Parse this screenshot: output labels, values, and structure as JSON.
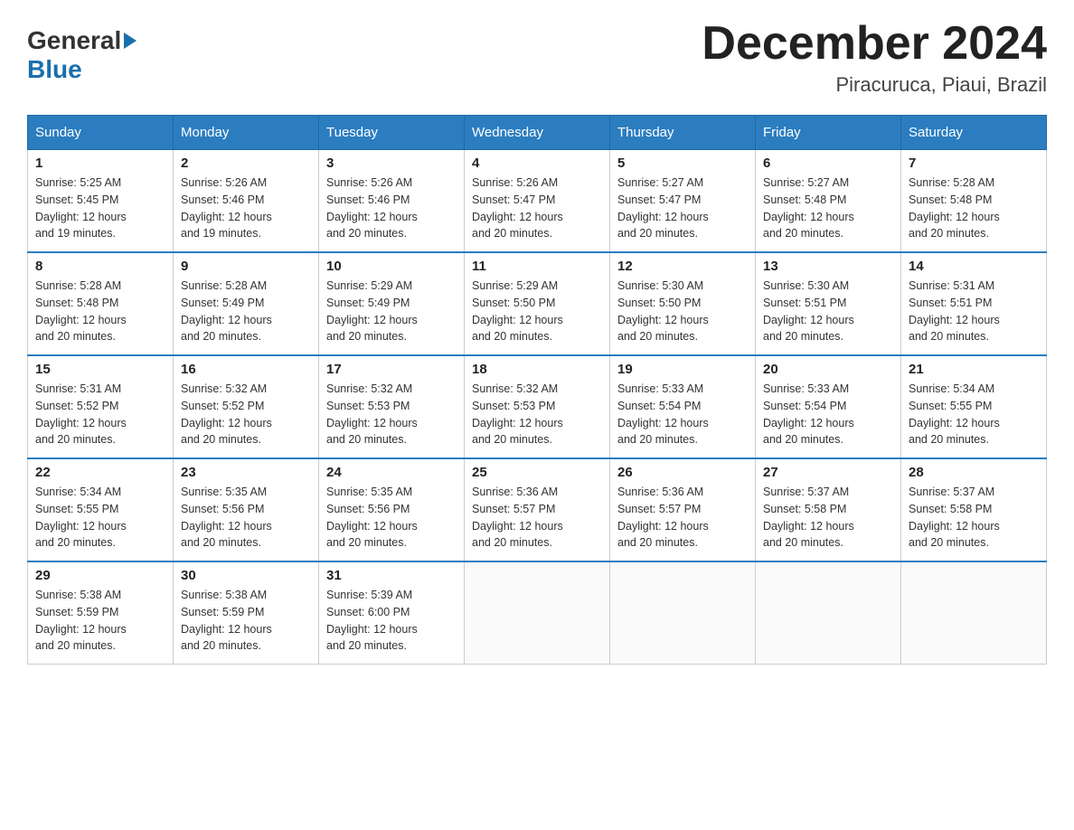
{
  "logo": {
    "text_general": "General",
    "text_blue": "Blue",
    "arrow": "▶"
  },
  "title": {
    "month_year": "December 2024",
    "location": "Piracuruca, Piaui, Brazil"
  },
  "headers": [
    "Sunday",
    "Monday",
    "Tuesday",
    "Wednesday",
    "Thursday",
    "Friday",
    "Saturday"
  ],
  "weeks": [
    [
      {
        "day": "1",
        "sunrise": "5:25 AM",
        "sunset": "5:45 PM",
        "daylight": "12 hours and 19 minutes."
      },
      {
        "day": "2",
        "sunrise": "5:26 AM",
        "sunset": "5:46 PM",
        "daylight": "12 hours and 19 minutes."
      },
      {
        "day": "3",
        "sunrise": "5:26 AM",
        "sunset": "5:46 PM",
        "daylight": "12 hours and 20 minutes."
      },
      {
        "day": "4",
        "sunrise": "5:26 AM",
        "sunset": "5:47 PM",
        "daylight": "12 hours and 20 minutes."
      },
      {
        "day": "5",
        "sunrise": "5:27 AM",
        "sunset": "5:47 PM",
        "daylight": "12 hours and 20 minutes."
      },
      {
        "day": "6",
        "sunrise": "5:27 AM",
        "sunset": "5:48 PM",
        "daylight": "12 hours and 20 minutes."
      },
      {
        "day": "7",
        "sunrise": "5:28 AM",
        "sunset": "5:48 PM",
        "daylight": "12 hours and 20 minutes."
      }
    ],
    [
      {
        "day": "8",
        "sunrise": "5:28 AM",
        "sunset": "5:48 PM",
        "daylight": "12 hours and 20 minutes."
      },
      {
        "day": "9",
        "sunrise": "5:28 AM",
        "sunset": "5:49 PM",
        "daylight": "12 hours and 20 minutes."
      },
      {
        "day": "10",
        "sunrise": "5:29 AM",
        "sunset": "5:49 PM",
        "daylight": "12 hours and 20 minutes."
      },
      {
        "day": "11",
        "sunrise": "5:29 AM",
        "sunset": "5:50 PM",
        "daylight": "12 hours and 20 minutes."
      },
      {
        "day": "12",
        "sunrise": "5:30 AM",
        "sunset": "5:50 PM",
        "daylight": "12 hours and 20 minutes."
      },
      {
        "day": "13",
        "sunrise": "5:30 AM",
        "sunset": "5:51 PM",
        "daylight": "12 hours and 20 minutes."
      },
      {
        "day": "14",
        "sunrise": "5:31 AM",
        "sunset": "5:51 PM",
        "daylight": "12 hours and 20 minutes."
      }
    ],
    [
      {
        "day": "15",
        "sunrise": "5:31 AM",
        "sunset": "5:52 PM",
        "daylight": "12 hours and 20 minutes."
      },
      {
        "day": "16",
        "sunrise": "5:32 AM",
        "sunset": "5:52 PM",
        "daylight": "12 hours and 20 minutes."
      },
      {
        "day": "17",
        "sunrise": "5:32 AM",
        "sunset": "5:53 PM",
        "daylight": "12 hours and 20 minutes."
      },
      {
        "day": "18",
        "sunrise": "5:32 AM",
        "sunset": "5:53 PM",
        "daylight": "12 hours and 20 minutes."
      },
      {
        "day": "19",
        "sunrise": "5:33 AM",
        "sunset": "5:54 PM",
        "daylight": "12 hours and 20 minutes."
      },
      {
        "day": "20",
        "sunrise": "5:33 AM",
        "sunset": "5:54 PM",
        "daylight": "12 hours and 20 minutes."
      },
      {
        "day": "21",
        "sunrise": "5:34 AM",
        "sunset": "5:55 PM",
        "daylight": "12 hours and 20 minutes."
      }
    ],
    [
      {
        "day": "22",
        "sunrise": "5:34 AM",
        "sunset": "5:55 PM",
        "daylight": "12 hours and 20 minutes."
      },
      {
        "day": "23",
        "sunrise": "5:35 AM",
        "sunset": "5:56 PM",
        "daylight": "12 hours and 20 minutes."
      },
      {
        "day": "24",
        "sunrise": "5:35 AM",
        "sunset": "5:56 PM",
        "daylight": "12 hours and 20 minutes."
      },
      {
        "day": "25",
        "sunrise": "5:36 AM",
        "sunset": "5:57 PM",
        "daylight": "12 hours and 20 minutes."
      },
      {
        "day": "26",
        "sunrise": "5:36 AM",
        "sunset": "5:57 PM",
        "daylight": "12 hours and 20 minutes."
      },
      {
        "day": "27",
        "sunrise": "5:37 AM",
        "sunset": "5:58 PM",
        "daylight": "12 hours and 20 minutes."
      },
      {
        "day": "28",
        "sunrise": "5:37 AM",
        "sunset": "5:58 PM",
        "daylight": "12 hours and 20 minutes."
      }
    ],
    [
      {
        "day": "29",
        "sunrise": "5:38 AM",
        "sunset": "5:59 PM",
        "daylight": "12 hours and 20 minutes."
      },
      {
        "day": "30",
        "sunrise": "5:38 AM",
        "sunset": "5:59 PM",
        "daylight": "12 hours and 20 minutes."
      },
      {
        "day": "31",
        "sunrise": "5:39 AM",
        "sunset": "6:00 PM",
        "daylight": "12 hours and 20 minutes."
      },
      null,
      null,
      null,
      null
    ]
  ],
  "labels": {
    "sunrise": "Sunrise:",
    "sunset": "Sunset:",
    "daylight": "Daylight:"
  }
}
